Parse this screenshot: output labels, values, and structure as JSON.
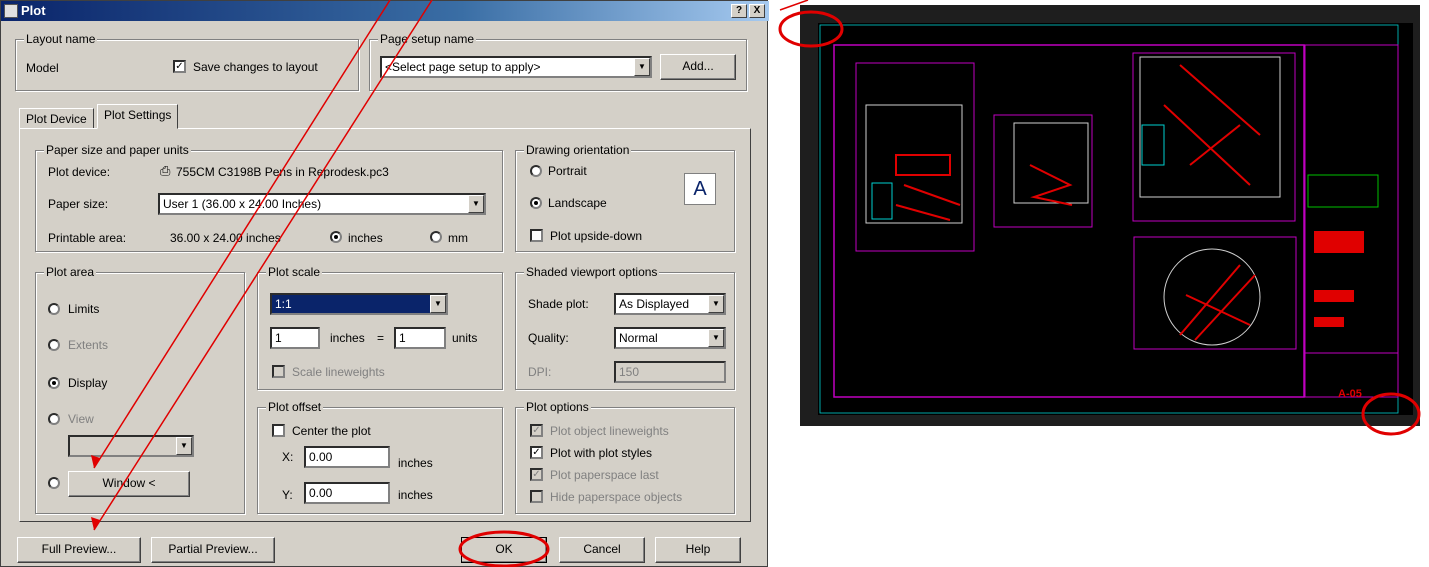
{
  "dialog": {
    "title": "Plot",
    "help_button": "?",
    "close_button": "X"
  },
  "layout_name": {
    "legend": "Layout name",
    "value": "Model",
    "save_changes_label": "Save changes to layout",
    "save_changes_checked": true
  },
  "page_setup": {
    "legend": "Page setup name",
    "selected": "<Select page setup to apply>",
    "add_button": "Add..."
  },
  "tabs": [
    {
      "label": "Plot Device",
      "active": false
    },
    {
      "label": "Plot Settings",
      "active": true
    }
  ],
  "paper": {
    "legend": "Paper size and paper units",
    "plot_device_label": "Plot device:",
    "plot_device_value": "755CM C3198B Pens in Reprodesk.pc3",
    "paper_size_label": "Paper size:",
    "paper_size_value": "User 1 (36.00 x 24.00 Inches)",
    "printable_label": "Printable area:",
    "printable_value": "36.00 x 24.00 inches",
    "units": [
      {
        "label": "inches",
        "selected": true
      },
      {
        "label": "mm",
        "selected": false
      }
    ]
  },
  "orientation": {
    "legend": "Drawing orientation",
    "options": [
      {
        "label": "Portrait",
        "selected": false
      },
      {
        "label": "Landscape",
        "selected": true
      }
    ],
    "upside_down_label": "Plot upside-down",
    "upside_down_checked": false,
    "preview_glyph": "A"
  },
  "plot_area": {
    "legend": "Plot area",
    "options": [
      {
        "label": "Limits",
        "selected": false,
        "enabled": true
      },
      {
        "label": "Extents",
        "selected": false,
        "enabled": false
      },
      {
        "label": "Display",
        "selected": true,
        "enabled": true
      },
      {
        "label": "View",
        "selected": false,
        "enabled": false
      }
    ],
    "window_button": "Window <"
  },
  "plot_scale": {
    "legend": "Plot scale",
    "selected": "1:1",
    "inches_value": "1",
    "inches_label": "inches",
    "equals": "=",
    "units_value": "1",
    "units_label": "units",
    "scale_lineweights_label": "Scale lineweights"
  },
  "shaded_viewport": {
    "legend": "Shaded viewport options",
    "shade_plot_label": "Shade plot:",
    "shade_plot_value": "As Displayed",
    "quality_label": "Quality:",
    "quality_value": "Normal",
    "dpi_label": "DPI:",
    "dpi_value": "150"
  },
  "plot_offset": {
    "legend": "Plot offset",
    "center_label": "Center the plot",
    "x_label": "X:",
    "x_value": "0.00",
    "y_label": "Y:",
    "y_value": "0.00",
    "units_label": "inches"
  },
  "plot_options": {
    "legend": "Plot options",
    "items": [
      {
        "label": "Plot object lineweights",
        "checked": true,
        "enabled": false
      },
      {
        "label": "Plot with plot styles",
        "checked": true,
        "enabled": true
      },
      {
        "label": "Plot paperspace last",
        "checked": true,
        "enabled": false
      },
      {
        "label": "Hide paperspace objects",
        "checked": false,
        "enabled": false
      }
    ]
  },
  "footer": {
    "full_preview": "Full Preview...",
    "partial_preview": "Partial Preview...",
    "ok": "OK",
    "cancel": "Cancel",
    "help": "Help"
  },
  "drawing": {
    "sheet_number": "A-05"
  },
  "colors": {
    "annotation": "#e00000",
    "magenta": "#c000c0",
    "cyan": "#00d0d0",
    "green": "#00c000"
  }
}
